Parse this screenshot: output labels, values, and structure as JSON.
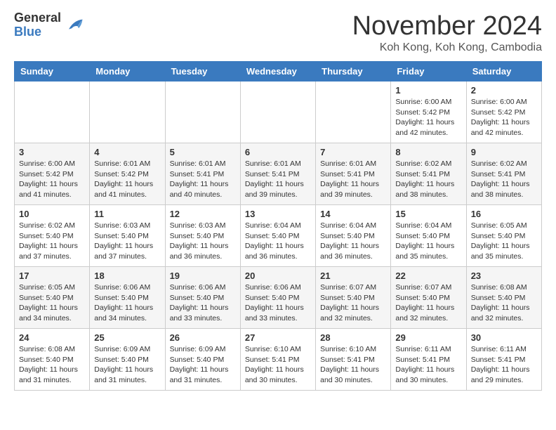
{
  "logo": {
    "general": "General",
    "blue": "Blue"
  },
  "header": {
    "month": "November 2024",
    "location": "Koh Kong, Koh Kong, Cambodia"
  },
  "days_of_week": [
    "Sunday",
    "Monday",
    "Tuesday",
    "Wednesday",
    "Thursday",
    "Friday",
    "Saturday"
  ],
  "weeks": [
    [
      {
        "day": "",
        "info": ""
      },
      {
        "day": "",
        "info": ""
      },
      {
        "day": "",
        "info": ""
      },
      {
        "day": "",
        "info": ""
      },
      {
        "day": "",
        "info": ""
      },
      {
        "day": "1",
        "info": "Sunrise: 6:00 AM\nSunset: 5:42 PM\nDaylight: 11 hours and 42 minutes."
      },
      {
        "day": "2",
        "info": "Sunrise: 6:00 AM\nSunset: 5:42 PM\nDaylight: 11 hours and 42 minutes."
      }
    ],
    [
      {
        "day": "3",
        "info": "Sunrise: 6:00 AM\nSunset: 5:42 PM\nDaylight: 11 hours and 41 minutes."
      },
      {
        "day": "4",
        "info": "Sunrise: 6:01 AM\nSunset: 5:42 PM\nDaylight: 11 hours and 41 minutes."
      },
      {
        "day": "5",
        "info": "Sunrise: 6:01 AM\nSunset: 5:41 PM\nDaylight: 11 hours and 40 minutes."
      },
      {
        "day": "6",
        "info": "Sunrise: 6:01 AM\nSunset: 5:41 PM\nDaylight: 11 hours and 39 minutes."
      },
      {
        "day": "7",
        "info": "Sunrise: 6:01 AM\nSunset: 5:41 PM\nDaylight: 11 hours and 39 minutes."
      },
      {
        "day": "8",
        "info": "Sunrise: 6:02 AM\nSunset: 5:41 PM\nDaylight: 11 hours and 38 minutes."
      },
      {
        "day": "9",
        "info": "Sunrise: 6:02 AM\nSunset: 5:41 PM\nDaylight: 11 hours and 38 minutes."
      }
    ],
    [
      {
        "day": "10",
        "info": "Sunrise: 6:02 AM\nSunset: 5:40 PM\nDaylight: 11 hours and 37 minutes."
      },
      {
        "day": "11",
        "info": "Sunrise: 6:03 AM\nSunset: 5:40 PM\nDaylight: 11 hours and 37 minutes."
      },
      {
        "day": "12",
        "info": "Sunrise: 6:03 AM\nSunset: 5:40 PM\nDaylight: 11 hours and 36 minutes."
      },
      {
        "day": "13",
        "info": "Sunrise: 6:04 AM\nSunset: 5:40 PM\nDaylight: 11 hours and 36 minutes."
      },
      {
        "day": "14",
        "info": "Sunrise: 6:04 AM\nSunset: 5:40 PM\nDaylight: 11 hours and 36 minutes."
      },
      {
        "day": "15",
        "info": "Sunrise: 6:04 AM\nSunset: 5:40 PM\nDaylight: 11 hours and 35 minutes."
      },
      {
        "day": "16",
        "info": "Sunrise: 6:05 AM\nSunset: 5:40 PM\nDaylight: 11 hours and 35 minutes."
      }
    ],
    [
      {
        "day": "17",
        "info": "Sunrise: 6:05 AM\nSunset: 5:40 PM\nDaylight: 11 hours and 34 minutes."
      },
      {
        "day": "18",
        "info": "Sunrise: 6:06 AM\nSunset: 5:40 PM\nDaylight: 11 hours and 34 minutes."
      },
      {
        "day": "19",
        "info": "Sunrise: 6:06 AM\nSunset: 5:40 PM\nDaylight: 11 hours and 33 minutes."
      },
      {
        "day": "20",
        "info": "Sunrise: 6:06 AM\nSunset: 5:40 PM\nDaylight: 11 hours and 33 minutes."
      },
      {
        "day": "21",
        "info": "Sunrise: 6:07 AM\nSunset: 5:40 PM\nDaylight: 11 hours and 32 minutes."
      },
      {
        "day": "22",
        "info": "Sunrise: 6:07 AM\nSunset: 5:40 PM\nDaylight: 11 hours and 32 minutes."
      },
      {
        "day": "23",
        "info": "Sunrise: 6:08 AM\nSunset: 5:40 PM\nDaylight: 11 hours and 32 minutes."
      }
    ],
    [
      {
        "day": "24",
        "info": "Sunrise: 6:08 AM\nSunset: 5:40 PM\nDaylight: 11 hours and 31 minutes."
      },
      {
        "day": "25",
        "info": "Sunrise: 6:09 AM\nSunset: 5:40 PM\nDaylight: 11 hours and 31 minutes."
      },
      {
        "day": "26",
        "info": "Sunrise: 6:09 AM\nSunset: 5:40 PM\nDaylight: 11 hours and 31 minutes."
      },
      {
        "day": "27",
        "info": "Sunrise: 6:10 AM\nSunset: 5:41 PM\nDaylight: 11 hours and 30 minutes."
      },
      {
        "day": "28",
        "info": "Sunrise: 6:10 AM\nSunset: 5:41 PM\nDaylight: 11 hours and 30 minutes."
      },
      {
        "day": "29",
        "info": "Sunrise: 6:11 AM\nSunset: 5:41 PM\nDaylight: 11 hours and 30 minutes."
      },
      {
        "day": "30",
        "info": "Sunrise: 6:11 AM\nSunset: 5:41 PM\nDaylight: 11 hours and 29 minutes."
      }
    ]
  ]
}
